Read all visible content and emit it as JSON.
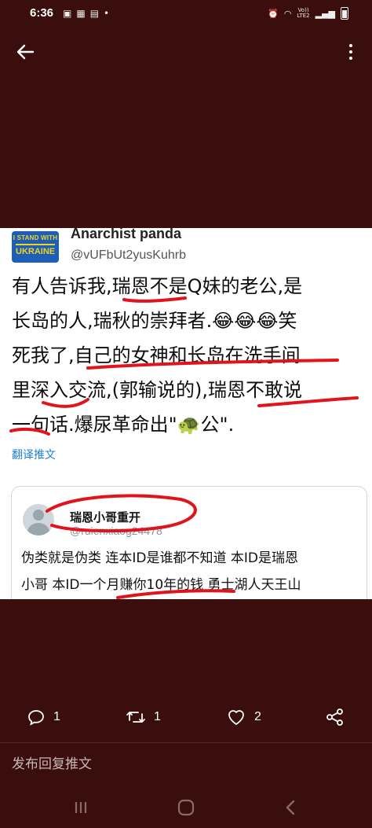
{
  "status_bar": {
    "time": "6:36",
    "left_icons": [
      "image-icon",
      "gallery-icon",
      "calendar-icon",
      "dot-icon"
    ],
    "network_label_top": "Vo))",
    "network_label_bottom": "LTE2"
  },
  "app_bar": {
    "back_icon": "arrow-left-icon",
    "more_icon": "more-vertical-icon"
  },
  "tweet": {
    "badge_line1": "I STAND WITH",
    "badge_line2": "UKRAINE",
    "author_name": "Anarchist panda",
    "author_handle": "@vUFbUt2yusKuhrb",
    "lines": [
      "有人告诉我,瑞恩不是Q妹的老公,是",
      "长岛的人,瑞秋的崇拜者.😂😂😂笑",
      "死我了,自己的女神和长岛在洗手间",
      "里深入交流,(郭输说的),瑞恩不敢说",
      "一句话.爆尿革命出\"🐢公\"."
    ],
    "translate_label": "翻译推文",
    "quote": {
      "name": "瑞恩小哥重开",
      "handle": "@ruienxiaog24478",
      "lines": [
        "伪类就是伪类 连本ID是谁都不知道  本ID是瑞恩",
        "小哥 本ID一个月赚你10年的钱 勇士湖人天王山"
      ]
    }
  },
  "actions": {
    "reply_count": "1",
    "retweet_count": "1",
    "like_count": "2",
    "icons": [
      "reply-icon",
      "retweet-icon",
      "like-icon",
      "share-icon"
    ]
  },
  "composer": {
    "placeholder": "发布回复推文"
  },
  "colors": {
    "background": "#3a0e0c",
    "annotation_red": "#e0141c",
    "link_blue": "#1d7fd0"
  }
}
